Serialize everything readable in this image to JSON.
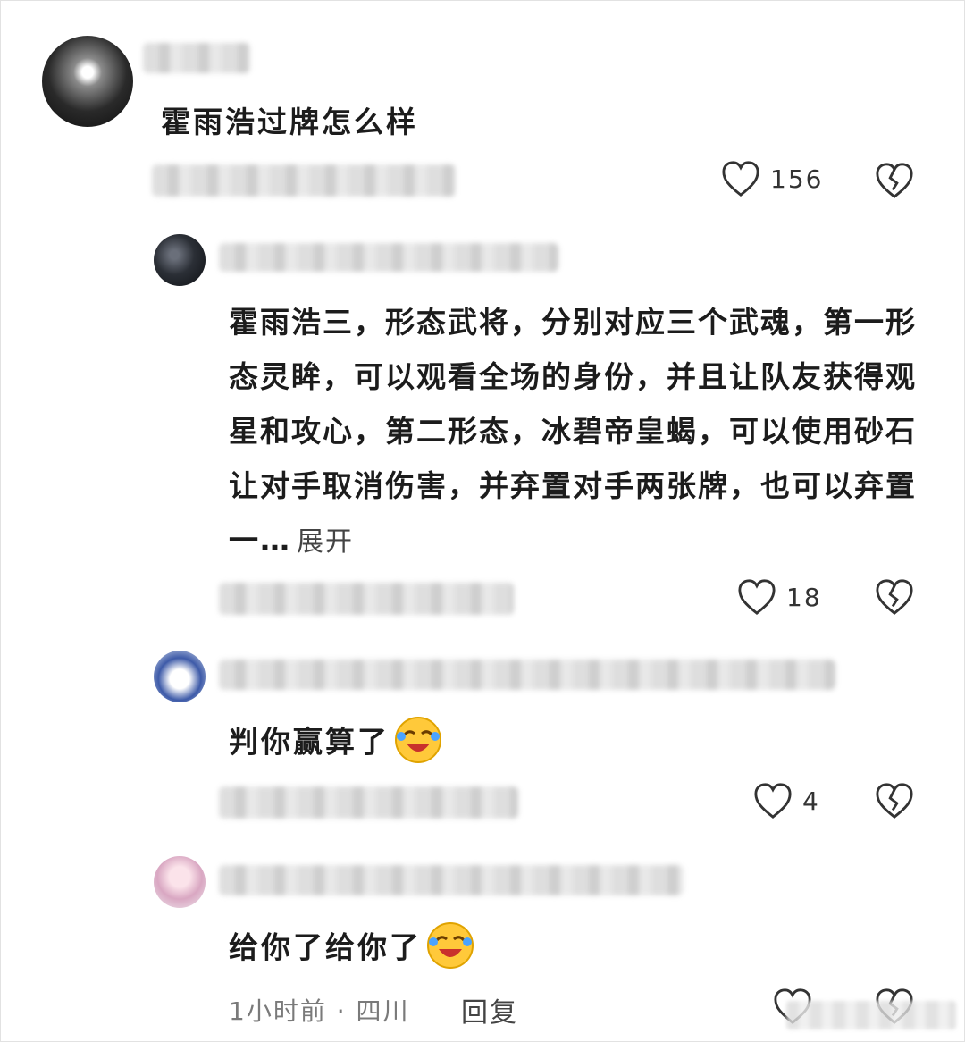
{
  "comments": [
    {
      "text": "霍雨浩过牌怎么样",
      "likes": "156"
    },
    {
      "text": "霍雨浩三，形态武将，分别对应三个武魂，第一形态灵眸，可以观看全场的身份，并且让队友获得观星和攻心，第二形态，冰碧帝皇蝎，可以使用砂石让对手取消伤害，并弃置对手两张牌，也可以弃置一…",
      "expand_label": "展开",
      "likes": "18"
    },
    {
      "text": "判你赢算了",
      "likes": "4"
    },
    {
      "text": "给你了给你了",
      "meta": "1小时前 · 四川",
      "reply_label": "回复"
    }
  ],
  "icons": {
    "like": "heart-outline-icon",
    "dislike": "broken-heart-icon",
    "emoji": "laughing-crying-emoji"
  }
}
